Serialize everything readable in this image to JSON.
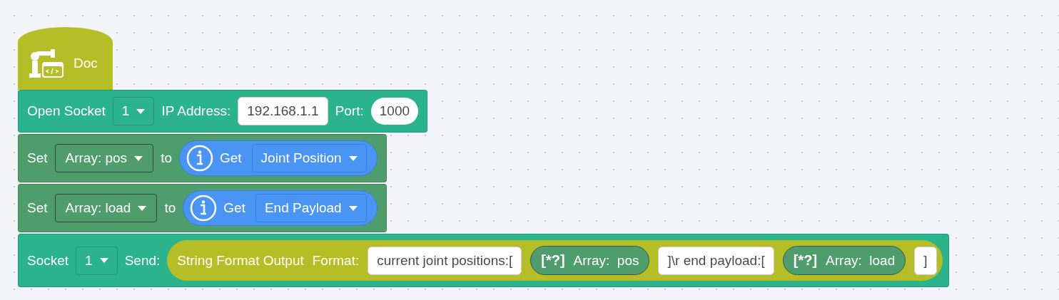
{
  "hat": {
    "label": "Doc"
  },
  "blocks": [
    {
      "kind": "socket",
      "parts": [
        {
          "kind": "label",
          "text": "Open Socket"
        },
        {
          "kind": "dropdown",
          "text": "1"
        },
        {
          "kind": "label",
          "text": "IP Address:"
        },
        {
          "kind": "field",
          "text": "192.168.1.1"
        },
        {
          "kind": "label",
          "text": "Port:"
        },
        {
          "kind": "number",
          "text": "1000"
        }
      ]
    },
    {
      "kind": "variable",
      "parts": [
        {
          "kind": "label",
          "text": "Set"
        },
        {
          "kind": "dropdown_box",
          "text": "Array: pos"
        },
        {
          "kind": "label",
          "text": "to"
        },
        {
          "kind": "getter",
          "label": "Get",
          "value": "Joint Position"
        }
      ]
    },
    {
      "kind": "variable",
      "parts": [
        {
          "kind": "label",
          "text": "Set"
        },
        {
          "kind": "dropdown_box",
          "text": "Array: load"
        },
        {
          "kind": "label",
          "text": "to"
        },
        {
          "kind": "getter",
          "label": "Get",
          "value": "End Payload"
        }
      ]
    },
    {
      "kind": "socket",
      "parts": [
        {
          "kind": "label",
          "text": "Socket"
        },
        {
          "kind": "dropdown",
          "text": "1"
        },
        {
          "kind": "label",
          "text": "Send:"
        },
        {
          "kind": "format",
          "title": "String Format Output",
          "label": "Format:",
          "items": [
            {
              "kind": "field",
              "text": "current joint positions:["
            },
            {
              "kind": "array",
              "symbol": "[*?]",
              "text": "Array:  pos"
            },
            {
              "kind": "field",
              "text": "]\\r end payload:["
            },
            {
              "kind": "array",
              "symbol": "[*?]",
              "text": "Array:  load"
            },
            {
              "kind": "field",
              "text": "]"
            }
          ]
        }
      ]
    }
  ]
}
